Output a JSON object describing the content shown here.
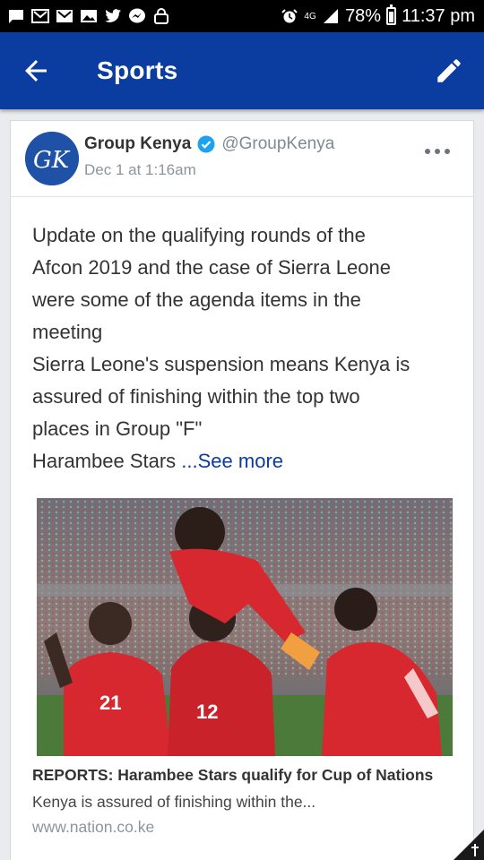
{
  "status_bar": {
    "network": "4G",
    "battery": "78%",
    "time": "11:37 pm",
    "notification_icons": [
      "message-icon",
      "gmail-outline-icon",
      "gmail-icon",
      "gallery-icon",
      "twitter-icon",
      "messenger-icon",
      "lock-icon"
    ],
    "battery_level": 0.78
  },
  "app_bar": {
    "title": "Sports",
    "background": "#0a3d9f"
  },
  "post": {
    "author_name": "Group Kenya",
    "handle": "@GroupKenya",
    "timestamp": "Dec 1 at 1:16am",
    "avatar_initials": "GK",
    "body_lines": [
      "Update on the qualifying rounds of the",
      "Afcon 2019 and the case of Sierra Leone",
      "were some of the agenda items in the",
      "meeting",
      "Sierra Leone's suspension means Kenya is",
      "assured of finishing within the top two",
      "places in Group \"F\"",
      "Harambee Stars "
    ],
    "see_more": "...See more"
  },
  "link_preview": {
    "title": "REPORTS: Harambee Stars qualify for Cup of Nations",
    "description": "Kenya is assured of finishing within the...",
    "domain": "www.nation.co.ke",
    "jersey_numbers": [
      "21",
      "12"
    ]
  },
  "colors": {
    "accent": "#0a3d9f",
    "verified": "#1da1f2",
    "jersey_red": "#d8282f"
  }
}
